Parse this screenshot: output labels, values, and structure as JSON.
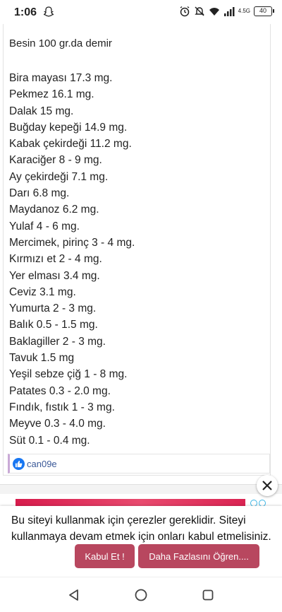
{
  "status_bar": {
    "time": "1:06",
    "network": "4.5G",
    "battery": "40"
  },
  "post": {
    "intro": "Besin 100 gr.da demir",
    "items": [
      "Bira mayası 17.3 mg.",
      "Pekmez 16.1 mg.",
      "Dalak 15 mg.",
      "Buğday kepeği 14.9 mg.",
      "Kabak çekirdeği 11.2 mg.",
      "Karaciğer 8 - 9 mg.",
      "Ay çekirdeği 7.1 mg.",
      "Darı 6.8 mg.",
      "Maydanoz 6.2 mg.",
      "Yulaf 4 - 6 mg.",
      "Mercimek, pirinç 3 - 4 mg.",
      "Kırmızı et 2 - 4 mg.",
      "Yer elması 3.4 mg.",
      "Ceviz 3.1 mg.",
      "Yumurta 2 - 3 mg.",
      "Balık 0.5 - 1.5 mg.",
      "Baklagiller 2 - 3 mg.",
      "Tavuk 1.5 mg",
      "Yeşil sebze çiğ 1 - 8 mg.",
      "Patates 0.3 - 2.0 mg.",
      "Fındık, fıstık 1 - 3 mg.",
      "Meyve 0.3 - 4.0 mg.",
      "Süt 0.1 - 0.4 mg."
    ],
    "liked_by": "can09e"
  },
  "cookie_banner": {
    "message": "Bu siteyi kullanmak için çerezler gereklidir. Siteyi kullanmaya devam etmek için onları kabul etmelisiniz.",
    "accept_label": "Kabul Et !",
    "more_label": "Daha Fazlasını Öğren...."
  },
  "colors": {
    "button": "#b8475f",
    "like": "#1877f2",
    "ad": "#d71b4c"
  },
  "icons": [
    "snapchat-icon",
    "alarm-icon",
    "mute-icon",
    "wifi-icon",
    "signal-icon",
    "battery-icon",
    "close-icon",
    "like-icon",
    "nav-back-icon",
    "nav-home-icon",
    "nav-recents-icon"
  ]
}
